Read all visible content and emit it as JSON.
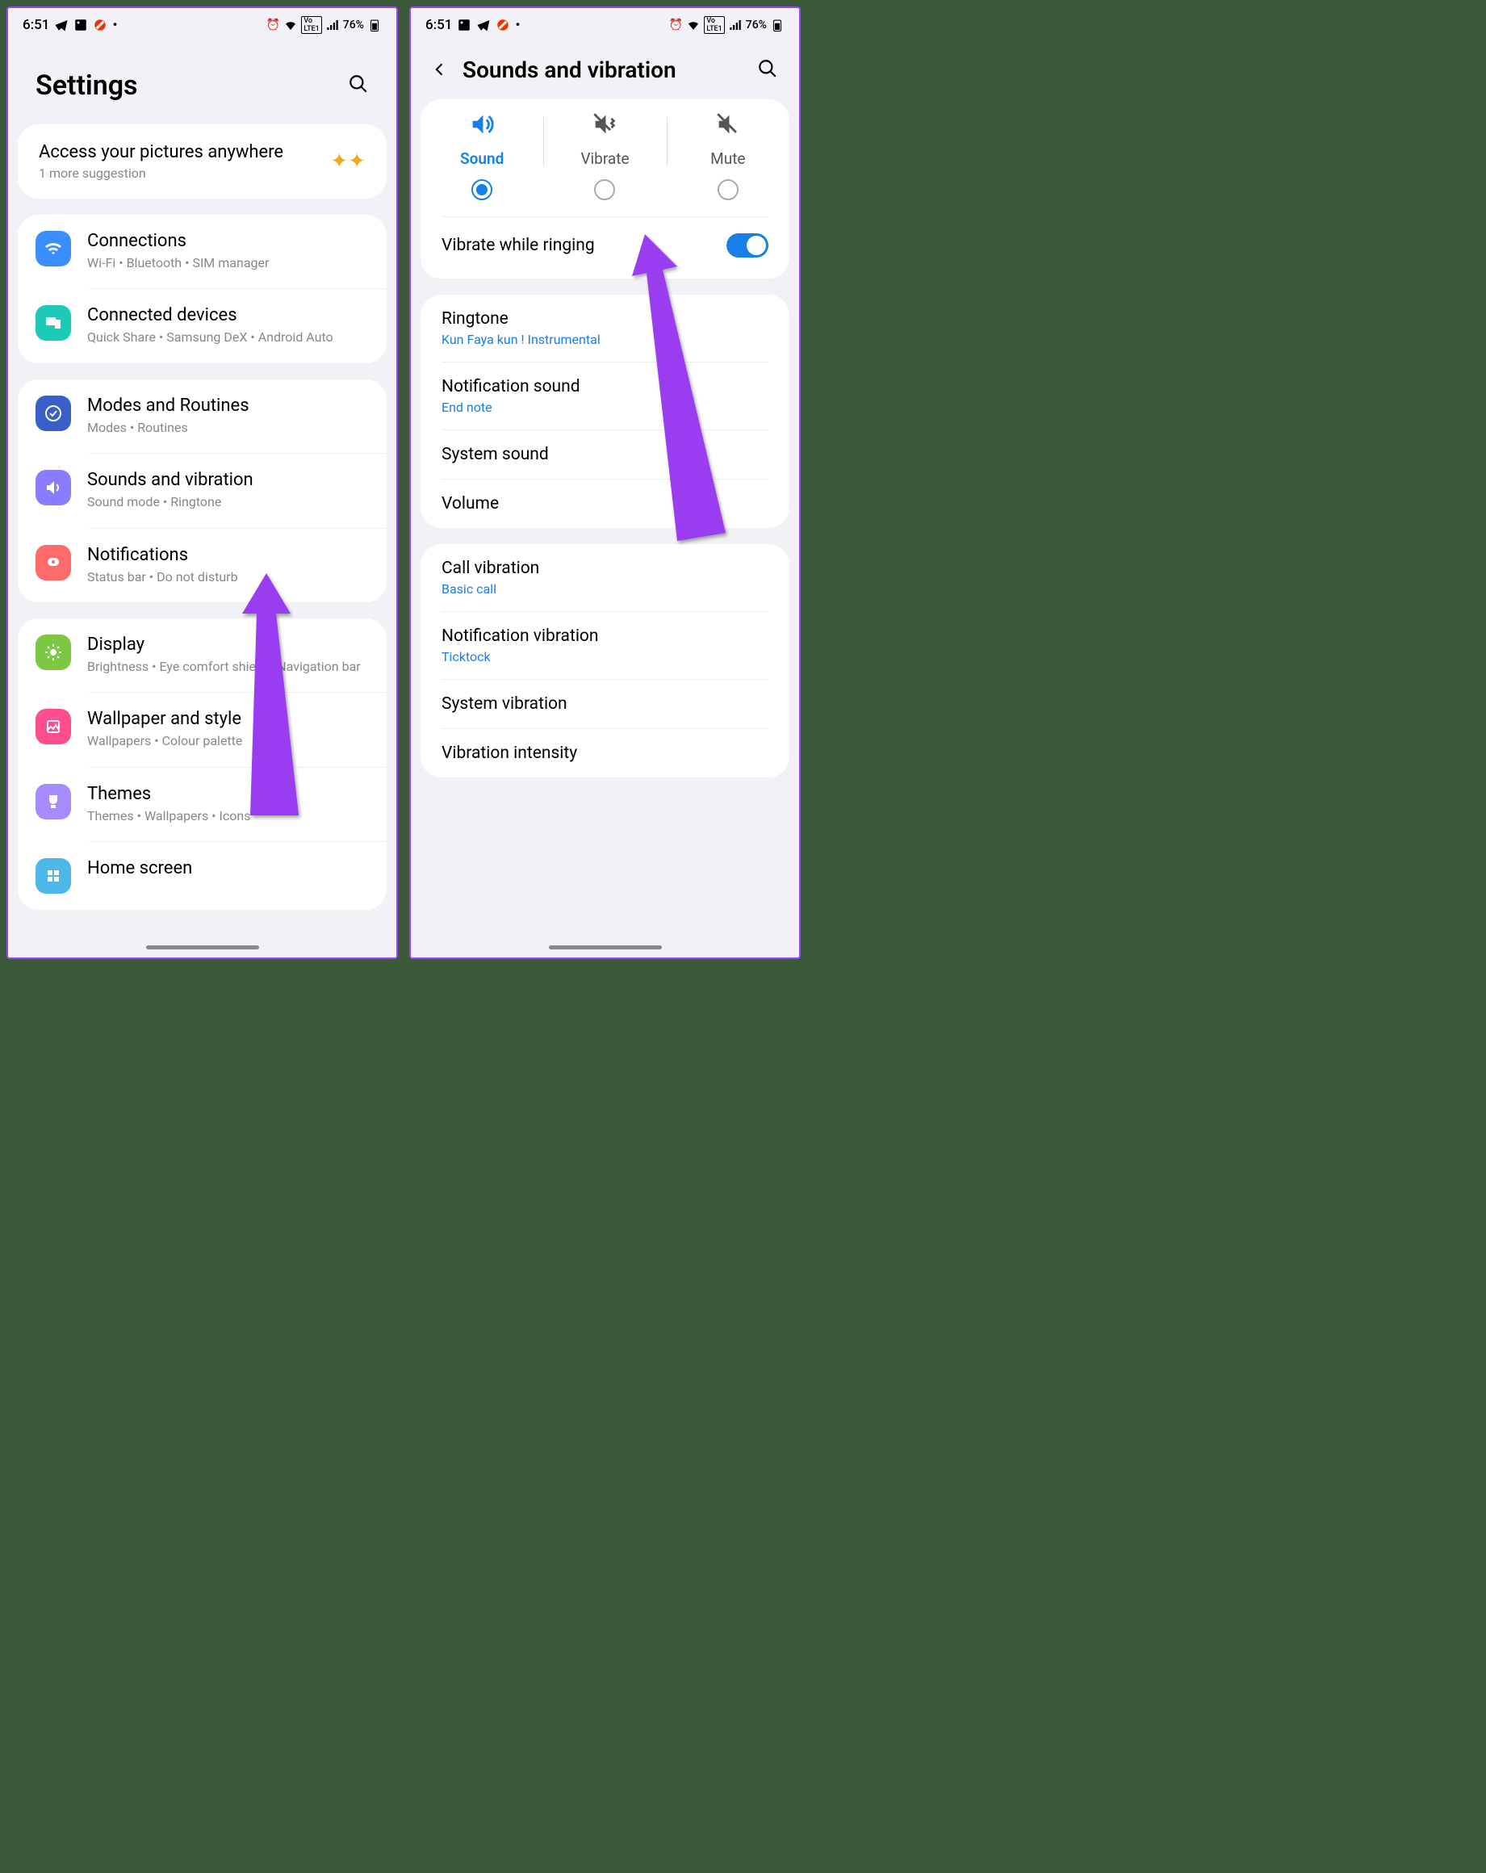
{
  "status": {
    "time": "6:51",
    "battery": "76%"
  },
  "left": {
    "title": "Settings",
    "suggest": {
      "title": "Access your pictures anywhere",
      "sub": "1 more suggestion"
    },
    "groups": [
      {
        "rows": [
          {
            "icon": "wifi",
            "cls": "ic-blue",
            "title": "Connections",
            "sub": "Wi-Fi  •  Bluetooth  •  SIM manager"
          },
          {
            "icon": "devices",
            "cls": "ic-teal",
            "title": "Connected devices",
            "sub": "Quick Share  •  Samsung DeX  •  Android Auto"
          }
        ]
      },
      {
        "rows": [
          {
            "icon": "routine",
            "cls": "ic-navy",
            "title": "Modes and Routines",
            "sub": "Modes  •  Routines"
          },
          {
            "icon": "sound",
            "cls": "ic-purple",
            "title": "Sounds and vibration",
            "sub": "Sound mode  •  Ringtone"
          },
          {
            "icon": "notif",
            "cls": "ic-coral",
            "title": "Notifications",
            "sub": "Status bar  •  Do not disturb"
          }
        ]
      },
      {
        "rows": [
          {
            "icon": "display",
            "cls": "ic-green",
            "title": "Display",
            "sub": "Brightness  •  Eye comfort shield  •  Navigation bar"
          },
          {
            "icon": "wallpaper",
            "cls": "ic-pink",
            "title": "Wallpaper and style",
            "sub": "Wallpapers  •  Colour palette"
          },
          {
            "icon": "themes",
            "cls": "ic-lav",
            "title": "Themes",
            "sub": "Themes  •  Wallpapers  •  Icons"
          },
          {
            "icon": "home",
            "cls": "ic-sky",
            "title": "Home screen",
            "sub": ""
          }
        ]
      }
    ]
  },
  "right": {
    "title": "Sounds and vibration",
    "modes": [
      {
        "label": "Sound",
        "selected": true
      },
      {
        "label": "Vibrate",
        "selected": false
      },
      {
        "label": "Mute",
        "selected": false
      }
    ],
    "vibrate_ringing": "Vibrate while ringing",
    "items1": [
      {
        "title": "Ringtone",
        "sub": "Kun Faya kun ! Instrumental"
      },
      {
        "title": "Notification sound",
        "sub": "End note"
      },
      {
        "title": "System sound",
        "sub": ""
      },
      {
        "title": "Volume",
        "sub": ""
      }
    ],
    "items2": [
      {
        "title": "Call vibration",
        "sub": "Basic call"
      },
      {
        "title": "Notification vibration",
        "sub": "Ticktock"
      },
      {
        "title": "System vibration",
        "sub": ""
      },
      {
        "title": "Vibration intensity",
        "sub": ""
      }
    ]
  }
}
